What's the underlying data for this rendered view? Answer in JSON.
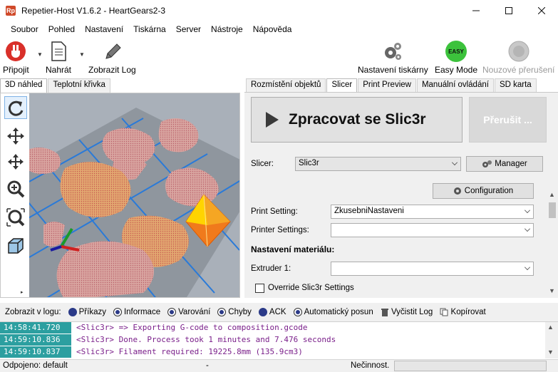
{
  "window": {
    "title": "Repetier-Host V1.6.2 - HeartGears2-3",
    "app_icon": "Rp"
  },
  "menu": [
    "Soubor",
    "Pohled",
    "Nastavení",
    "Tiskárna",
    "Server",
    "Nástroje",
    "Nápověda"
  ],
  "toolbar": {
    "connect_label": "Připojit",
    "load_label": "Nahrát",
    "show_log_label": "Zobrazit Log",
    "printer_settings_label": "Nastavení tiskárny",
    "easy_mode_label": "Easy Mode",
    "easy_badge": "EASY",
    "emergency_label": "Nouzové přerušení"
  },
  "left_tabs": [
    "3D náhled",
    "Teplotní křivka"
  ],
  "right_tabs": [
    "Rozmístění objektů",
    "Slicer",
    "Print Preview",
    "Manuální ovládání",
    "SD karta"
  ],
  "slicer": {
    "slice_button": "Zpracovat se Slic3r",
    "abort_button": "Přerušit ...",
    "slicer_label": "Slicer:",
    "slicer_value": "Slic3r",
    "manager_button": "Manager",
    "configuration_button": "Configuration",
    "print_setting_label": "Print Setting:",
    "print_setting_value": "ZkusebniNastaveni",
    "printer_settings_label": "Printer Settings:",
    "printer_settings_value": "",
    "material_heading": "Nastavení materiálu:",
    "extruder_label": "Extruder 1:",
    "extruder_value": "",
    "override_label": "Override Slic3r Settings"
  },
  "log_filter": {
    "label": "Zobrazit v logu:",
    "items": [
      "Příkazy",
      "Informace",
      "Varování",
      "Chyby",
      "ACK",
      "Automatický posun"
    ],
    "clear_label": "Vyčistit Log",
    "copy_label": "Kopírovat"
  },
  "log": [
    {
      "time": "14:58:41.720",
      "message": "<Slic3r> => Exporting G-code to composition.gcode"
    },
    {
      "time": "14:59:10.836",
      "message": "<Slic3r> Done. Process took 1 minutes and 7.476 seconds"
    },
    {
      "time": "14:59:10.837",
      "message": "<Slic3r> Filament required: 19225.8mm (135.9cm3)"
    }
  ],
  "status": {
    "connection": "Odpojeno: default",
    "middle": "-",
    "state": "Nečinnost."
  },
  "colors": {
    "log_time_bg": "#2c9fa0",
    "log_msg": "#7a1f8a",
    "model": "#e2a770",
    "selected_model": "#f07a1c",
    "bed_grid": "#2a7ad8"
  }
}
